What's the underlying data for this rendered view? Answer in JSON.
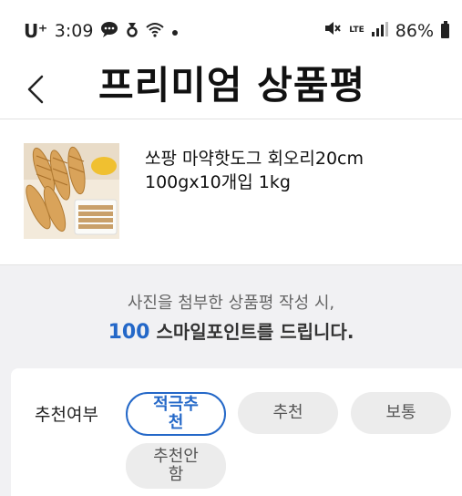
{
  "status_bar": {
    "carrier": "U⁺",
    "time": "3:09",
    "network": "LTE",
    "battery": "86%"
  },
  "header": {
    "title": "프리미엄 상품평",
    "back_icon": "chevron-left-icon"
  },
  "product": {
    "name_line1": "쏘팡 마약핫도그 회오리20cm",
    "name_line2": "100gx10개입 1kg"
  },
  "notice": {
    "line1": "사진을 첨부한 상품평 작성 시,",
    "points": "100",
    "line2_suffix": " 스마일포인트를 드립니다."
  },
  "recommend": {
    "label": "추천여부",
    "options": [
      {
        "line1": "적극추",
        "line2": "천",
        "selected": true
      },
      {
        "line1": "추천",
        "line2": "",
        "selected": false
      },
      {
        "line1": "보통",
        "line2": "",
        "selected": false
      },
      {
        "line1": "추천안",
        "line2": "함",
        "selected": false
      }
    ]
  },
  "colors": {
    "accent": "#2468c8",
    "chip_bg": "#ececec",
    "page_bg": "#f1f1f3"
  }
}
